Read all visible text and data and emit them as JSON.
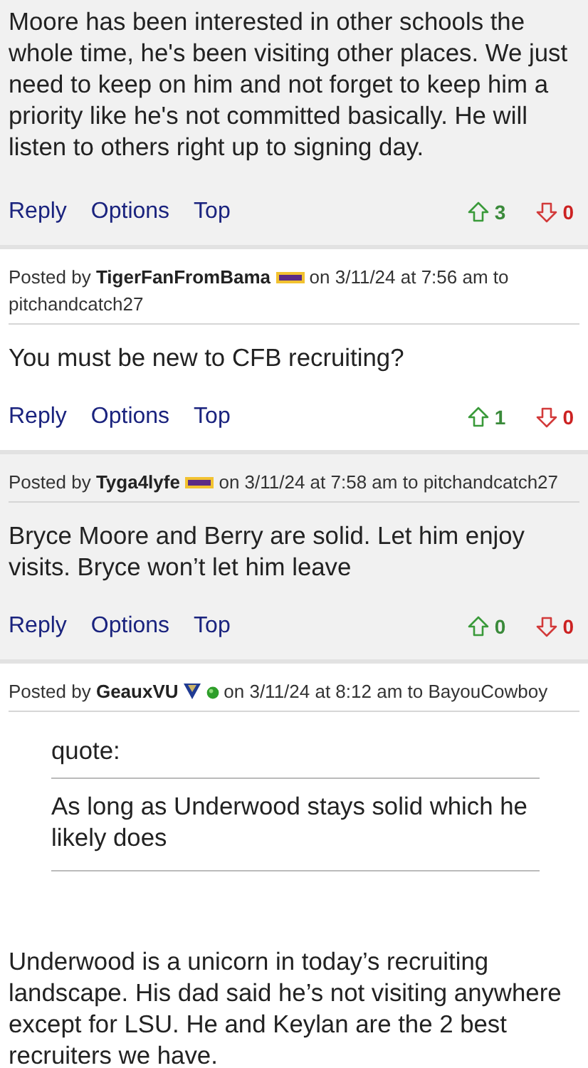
{
  "posts": [
    {
      "body": [
        "Moore has been interested in other schools the whole time, he's been visiting other places. We just need to keep on him and not forget to keep him a priority like he's not committed basically. He will listen to others right up to signing day."
      ],
      "actions": [
        "Reply",
        "Options",
        "Top"
      ],
      "upvotes": "3",
      "downvotes": "0"
    },
    {
      "header": {
        "prefix": "Posted by",
        "author": "TigerFanFromBama",
        "badges": [
          {
            "kind": "lsu"
          }
        ],
        "suffix": "on 3/11/24 at 7:56 am to",
        "recipient": "pitchandcatch27"
      },
      "body": [
        "You must be new to CFB recruiting?"
      ],
      "actions": [
        "Reply",
        "Options",
        "Top"
      ],
      "upvotes": "1",
      "downvotes": "0"
    },
    {
      "header": {
        "prefix": "Posted by",
        "author": "Tyga4lyfe",
        "badges": [
          {
            "kind": "lsu"
          }
        ],
        "suffix": "on 3/11/24 at 7:58 am to",
        "recipient": "pitchandcatch27"
      },
      "body": [
        "Bryce Moore and Berry are solid. Let him enjoy visits. Bryce won’t let him leave"
      ],
      "actions": [
        "Reply",
        "Options",
        "Top"
      ],
      "upvotes": "0",
      "downvotes": "0"
    },
    {
      "header": {
        "prefix": "Posted by",
        "author": "GeauxVU",
        "badges": [
          {
            "kind": "vu"
          },
          {
            "kind": "online"
          }
        ],
        "suffix": "on 3/11/24 at 8:12 am to",
        "recipient": "BayouCowboy"
      },
      "quote": {
        "label": "quote:",
        "text": "As long as Underwood stays solid which he likely does"
      },
      "body": [
        "Underwood is a unicorn in today’s recruiting landscape. His dad said he’s not visiting anywhere except for LSU. He and Keylan are the 2 best recruiters we have."
      ]
    }
  ]
}
